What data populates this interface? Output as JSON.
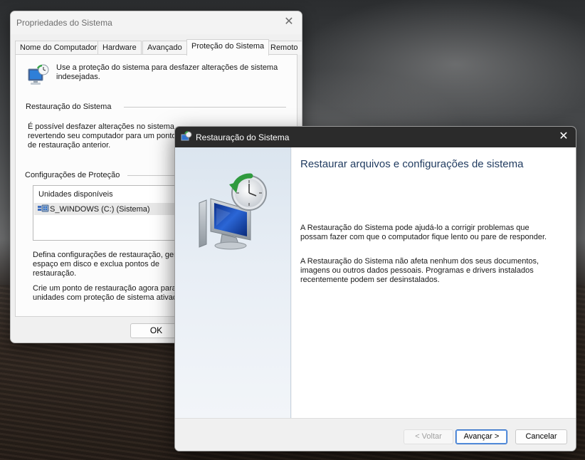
{
  "system_properties": {
    "title": "Propriedades do Sistema",
    "tabs": [
      {
        "label": "Nome do Computador"
      },
      {
        "label": "Hardware"
      },
      {
        "label": "Avançado"
      },
      {
        "label": "Proteção do Sistema",
        "active": true
      },
      {
        "label": "Remoto"
      }
    ],
    "intro": "Use a proteção do sistema para desfazer alterações de sistema indesejadas.",
    "restore_section": {
      "title": "Restauração do Sistema",
      "text": "É possível desfazer alterações no sistema revertendo seu computador para um ponto de restauração anterior."
    },
    "protection_section": {
      "title": "Configurações de Proteção",
      "drives_header": "Unidades disponíveis",
      "drives": [
        {
          "label": "S_WINDOWS (C:) (Sistema)"
        }
      ],
      "config_text": "Defina configurações de restauração, gere espaço em disco e exclua pontos de restauração.",
      "create_text": "Crie um ponto de restauração agora para a unidades com proteção de sistema ativad"
    },
    "ok_label": "OK"
  },
  "system_restore": {
    "title": "Restauração do Sistema",
    "heading": "Restaurar arquivos e configurações de sistema",
    "paragraph1": "A Restauração do Sistema pode ajudá-lo a corrigir problemas que possam fazer com que o computador fique lento ou pare de responder.",
    "paragraph2": "A Restauração do Sistema não afeta nenhum dos seus documentos, imagens ou outros dados pessoais. Programas e drivers instalados recentemente podem ser desinstalados.",
    "buttons": {
      "back": "< Voltar",
      "next": "Avançar >",
      "cancel": "Cancelar"
    },
    "back_enabled": false
  },
  "colors": {
    "accent": "#2c6bc6",
    "titlebar_dark": "#2b2b2b",
    "heading": "#1f3a5f"
  }
}
